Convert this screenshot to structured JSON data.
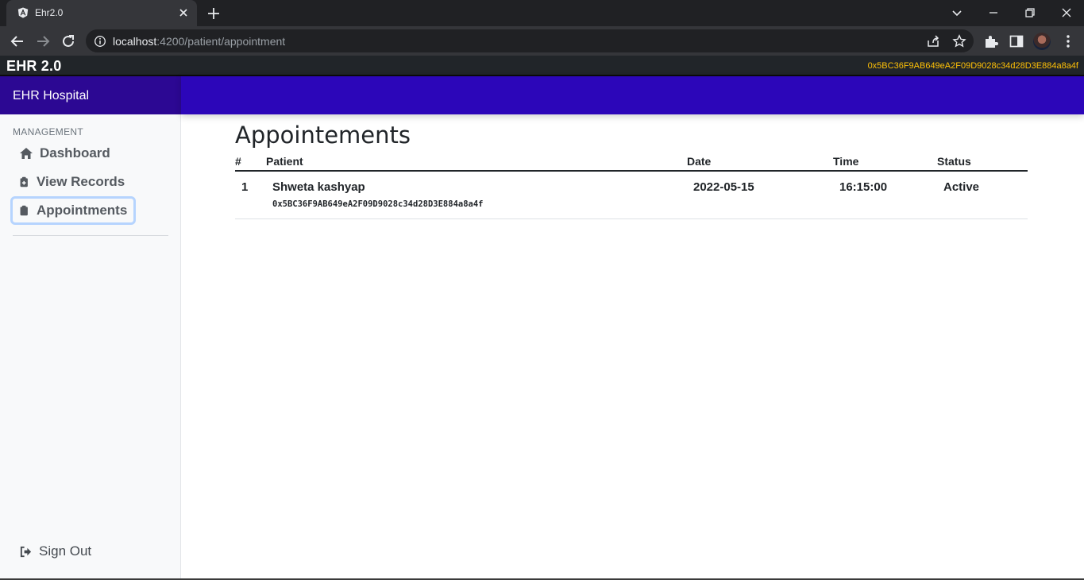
{
  "browser": {
    "tab_title": "Ehr2.0",
    "url_host": "localhost",
    "url_path": ":4200/patient/appointment"
  },
  "app": {
    "brand": "EHR 2.0",
    "account_address": "0x5BC36F9AB649eA2F09D9028c34d28D3E884a8a4f"
  },
  "sidebar": {
    "title": "EHR Hospital",
    "section_label": "MANAGEMENT",
    "items": [
      {
        "label": "Dashboard",
        "icon": "home-icon"
      },
      {
        "label": "View Records",
        "icon": "medical-clipboard-icon"
      },
      {
        "label": "Appointments",
        "icon": "clipboard-icon",
        "active": true
      }
    ],
    "signout_label": "Sign Out"
  },
  "main": {
    "title": "Appointements",
    "columns": [
      "#",
      "Patient",
      "Date",
      "Time",
      "Status"
    ],
    "rows": [
      {
        "index": "1",
        "patient_name": "Shweta kashyap",
        "patient_address": "0x5BC36F9AB649eA2F09D9028c34d28D3E884a8a4f",
        "date": "2022-05-15",
        "time": "16:15:00",
        "status": "Active"
      }
    ]
  },
  "colors": {
    "sidebar_header": "#2c0893",
    "top_band": "#2c06b9",
    "address_text": "#ffc107",
    "status_active": "#2e8b57",
    "active_nav_border": "#b6d4fe"
  }
}
